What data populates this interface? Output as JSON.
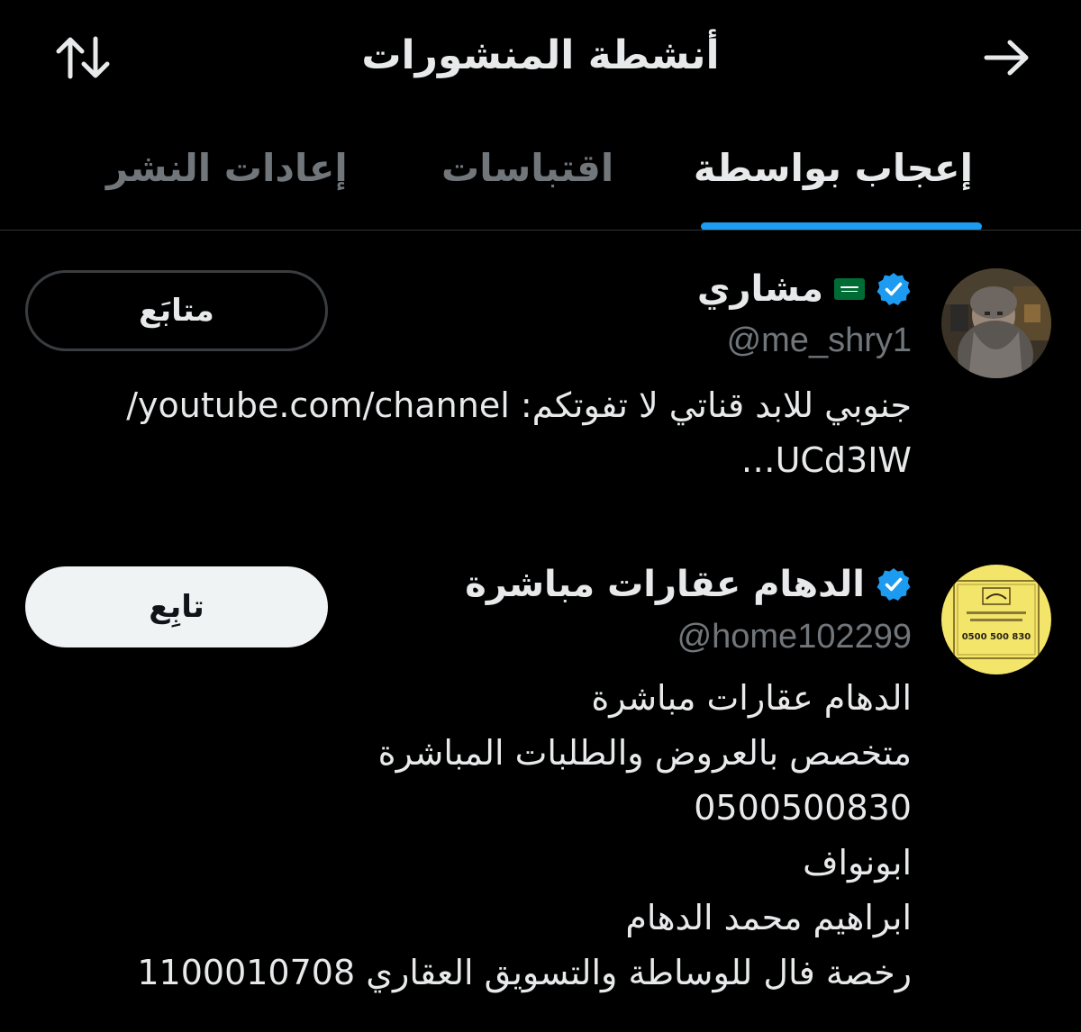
{
  "header": {
    "title": "أنشطة المنشورات",
    "back_icon": "arrow-right-icon",
    "sort_icon": "sort-arrows-icon"
  },
  "tabs": [
    {
      "label": "إعجاب بواسطة",
      "active": true
    },
    {
      "label": "اقتباسات",
      "active": false
    },
    {
      "label": "إعادات النشر",
      "active": false
    }
  ],
  "colors": {
    "accent": "#1d9bf0",
    "background": "#000000",
    "muted": "#71767b"
  },
  "users": [
    {
      "name": "مشاري",
      "flag": "saudi-flag-icon",
      "verified": true,
      "handle": "@me_shry1",
      "bio_lines": [
        "جنوبي للابد قناتي لا تفوتكم: youtube.com/channel/",
        "UCd3IW…"
      ],
      "button": "متابَع"
    },
    {
      "name": "الدهام عقارات مباشرة",
      "verified": true,
      "handle": "@home102299",
      "bio_lines": [
        "الدهام عقارات مباشرة",
        "متخصص بالعروض والطلبات المباشرة",
        "0500500830",
        "ابونواف",
        "ابراهيم محمد الدهام",
        "رخصة فال للوساطة والتسويق العقاري 1100010708"
      ],
      "button": "تابِع",
      "avatar_text": "0500 500 830"
    }
  ]
}
